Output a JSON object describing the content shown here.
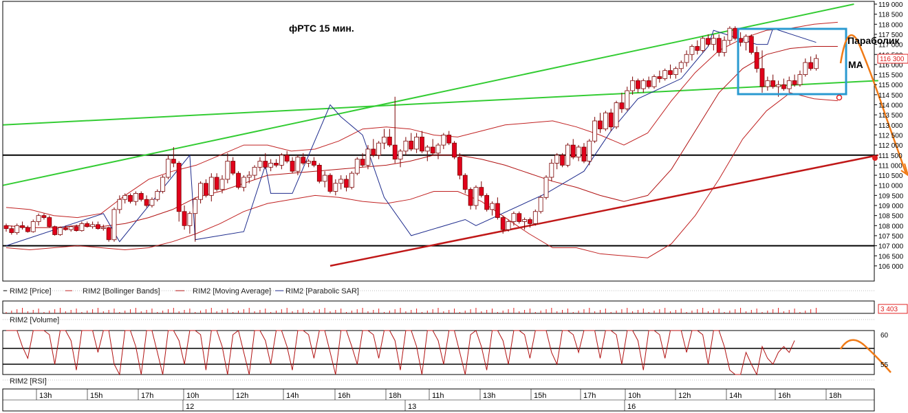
{
  "chart_title": "фРТС   15 мин.",
  "annotations": {
    "parabolic": "Параболик",
    "ma": "MA"
  },
  "price_panel": {
    "legend": [
      "RIM2 [Price]",
      "RIM2 [Bollinger Bands]",
      "RIM2 [Moving Average]",
      "RIM2 [Parabolic SAR]"
    ],
    "y_ticks": [
      "119 000",
      "118 500",
      "118 000",
      "117 500",
      "117 000",
      "116 500",
      "116 000",
      "115 500",
      "115 000",
      "114 500",
      "114 000",
      "113 500",
      "113 000",
      "112 500",
      "112 000",
      "111 500",
      "111 000",
      "110 500",
      "110 000",
      "109 500",
      "109 000",
      "108 500",
      "108 000",
      "107 500",
      "107 000",
      "106 500",
      "106 000"
    ],
    "last_price": "116 300"
  },
  "volume_panel": {
    "legend": "RIM2 [Volume]",
    "last_value": "3 403"
  },
  "rsi_panel": {
    "legend": "RIM2 [RSI]",
    "y_ticks": [
      "60",
      "55"
    ]
  },
  "time_axis": {
    "hours": [
      "13h",
      "15h",
      "17h",
      "10h",
      "12h",
      "14h",
      "16h",
      "18h",
      "11h",
      "13h",
      "15h",
      "17h",
      "10h",
      "12h",
      "14h",
      "16h",
      "18h"
    ],
    "days": [
      "12",
      "13",
      "16"
    ]
  },
  "colors": {
    "up": "#ffffff",
    "down": "#e0001b",
    "bollinger": "#c02020",
    "ma": "#b01010",
    "sar": "#1c2a8c",
    "green_line": "#33cc33",
    "red_trend": "#c01818",
    "box": "#2a9ad0",
    "forecast": "#f07a16"
  },
  "chart_data": {
    "type": "candlestick",
    "title": "фРТС   15 мин.",
    "series_names": [
      "RIM2 [Price]",
      "RIM2 [Bollinger Bands]",
      "RIM2 [Moving Average]",
      "RIM2 [Parabolic SAR]",
      "RIM2 [Volume]",
      "RIM2 [RSI]"
    ],
    "ylim": [
      106000,
      119000
    ],
    "horizontal_levels": [
      111500,
      107000
    ],
    "last_price": 116300,
    "rsi_levels": [
      58,
      56
    ],
    "candles": [
      [
        108000,
        108100,
        107700,
        107850
      ],
      [
        107850,
        108000,
        107550,
        107650
      ],
      [
        107650,
        108100,
        107550,
        108000
      ],
      [
        108000,
        108200,
        107800,
        107900
      ],
      [
        107900,
        108000,
        107650,
        107700
      ],
      [
        107700,
        108300,
        107650,
        108200
      ],
      [
        108200,
        108600,
        108000,
        108500
      ],
      [
        108500,
        108600,
        108300,
        108400
      ],
      [
        108400,
        108500,
        107900,
        107950
      ],
      [
        107950,
        108000,
        107500,
        107550
      ],
      [
        107550,
        107950,
        107500,
        107900
      ],
      [
        107900,
        108000,
        107750,
        107800
      ],
      [
        107800,
        108000,
        107700,
        107950
      ],
      [
        107950,
        108050,
        107700,
        107750
      ],
      [
        107750,
        108200,
        107700,
        108100
      ],
      [
        108100,
        108200,
        107900,
        107950
      ],
      [
        107950,
        108200,
        107850,
        108050
      ],
      [
        108050,
        108200,
        107800,
        107850
      ],
      [
        107850,
        108050,
        107750,
        107900
      ],
      [
        107900,
        107950,
        107200,
        107300
      ],
      [
        107300,
        108900,
        107200,
        108800
      ],
      [
        108800,
        109500,
        108600,
        109300
      ],
      [
        109300,
        109600,
        109100,
        109500
      ],
      [
        109500,
        109600,
        109100,
        109200
      ],
      [
        109200,
        109700,
        109000,
        109600
      ],
      [
        109600,
        109700,
        109200,
        109300
      ],
      [
        109300,
        109500,
        108900,
        109000
      ],
      [
        109000,
        109400,
        108900,
        109300
      ],
      [
        109300,
        109800,
        109200,
        109700
      ],
      [
        109700,
        110500,
        109600,
        110400
      ],
      [
        110400,
        111500,
        110300,
        111300
      ],
      [
        111300,
        111900,
        110900,
        111100
      ],
      [
        111100,
        111200,
        108200,
        108700
      ],
      [
        108700,
        109000,
        107800,
        108000
      ],
      [
        108000,
        108700,
        107600,
        108600
      ],
      [
        108600,
        109400,
        107200,
        109300
      ],
      [
        109300,
        110200,
        109100,
        110100
      ],
      [
        110100,
        110300,
        109400,
        109500
      ],
      [
        109500,
        110600,
        109200,
        110400
      ],
      [
        110400,
        110600,
        109700,
        109800
      ],
      [
        109800,
        110500,
        109600,
        110300
      ],
      [
        110300,
        111600,
        110100,
        111200
      ],
      [
        111200,
        111400,
        110500,
        110600
      ],
      [
        110600,
        110700,
        109800,
        109900
      ],
      [
        109900,
        110500,
        109700,
        110400
      ],
      [
        110400,
        110700,
        110100,
        110500
      ],
      [
        110500,
        111000,
        110300,
        110900
      ],
      [
        110900,
        111400,
        110700,
        111200
      ],
      [
        111200,
        111600,
        110800,
        110900
      ],
      [
        110900,
        111300,
        110700,
        111100
      ],
      [
        111100,
        111300,
        110900,
        111000
      ],
      [
        111000,
        111600,
        110800,
        111500
      ],
      [
        111500,
        111700,
        111100,
        111200
      ],
      [
        111200,
        111400,
        110600,
        110700
      ],
      [
        110700,
        111500,
        110500,
        111400
      ],
      [
        111400,
        111600,
        111000,
        111100
      ],
      [
        111100,
        111300,
        110900,
        111200
      ],
      [
        111200,
        111400,
        110900,
        111000
      ],
      [
        111000,
        111100,
        110100,
        110200
      ],
      [
        110200,
        110700,
        109900,
        110500
      ],
      [
        110500,
        110600,
        109600,
        109700
      ],
      [
        109700,
        110300,
        109500,
        110100
      ],
      [
        110100,
        110500,
        109800,
        110300
      ],
      [
        110300,
        110500,
        109700,
        109900
      ],
      [
        109900,
        110700,
        109800,
        110600
      ],
      [
        110600,
        111400,
        110500,
        111300
      ],
      [
        111300,
        111600,
        110900,
        111000
      ],
      [
        111000,
        112000,
        110800,
        111800
      ],
      [
        111800,
        112300,
        111400,
        111500
      ],
      [
        111500,
        112200,
        111300,
        112100
      ],
      [
        112100,
        112800,
        111800,
        112400
      ],
      [
        112400,
        112800,
        111900,
        112000
      ],
      [
        112000,
        114400,
        111100,
        111300
      ],
      [
        111300,
        111800,
        110900,
        111700
      ],
      [
        111700,
        112400,
        111500,
        112200
      ],
      [
        112200,
        112600,
        111700,
        111800
      ],
      [
        111800,
        112600,
        111600,
        112400
      ],
      [
        112400,
        112700,
        111600,
        111700
      ],
      [
        111700,
        112000,
        111200,
        111900
      ],
      [
        111900,
        112300,
        111500,
        111600
      ],
      [
        111600,
        112100,
        111300,
        112000
      ],
      [
        112000,
        112600,
        111800,
        112500
      ],
      [
        112500,
        112700,
        112000,
        112100
      ],
      [
        112100,
        112200,
        111300,
        111400
      ],
      [
        111400,
        111600,
        110300,
        110500
      ],
      [
        110500,
        110600,
        109600,
        109800
      ],
      [
        109800,
        109900,
        108800,
        109000
      ],
      [
        109000,
        110000,
        108800,
        109900
      ],
      [
        109900,
        110200,
        109400,
        109500
      ],
      [
        109500,
        109600,
        108700,
        108800
      ],
      [
        108800,
        109200,
        108500,
        109100
      ],
      [
        109100,
        109400,
        108300,
        108400
      ],
      [
        108400,
        108500,
        107600,
        107800
      ],
      [
        107800,
        108300,
        107700,
        108200
      ],
      [
        108200,
        108700,
        108000,
        108600
      ],
      [
        108600,
        108700,
        108100,
        108200
      ],
      [
        108200,
        108400,
        107800,
        108300
      ],
      [
        108300,
        108400,
        107900,
        108100
      ],
      [
        108100,
        108800,
        108000,
        108700
      ],
      [
        108700,
        109500,
        108600,
        109400
      ],
      [
        109400,
        110500,
        109300,
        110400
      ],
      [
        110400,
        111300,
        110200,
        111100
      ],
      [
        111100,
        111600,
        110800,
        111500
      ],
      [
        111500,
        111600,
        110900,
        111000
      ],
      [
        111000,
        112100,
        110900,
        112000
      ],
      [
        112000,
        112300,
        111300,
        111400
      ],
      [
        111400,
        112000,
        111200,
        111900
      ],
      [
        111900,
        112100,
        111100,
        111200
      ],
      [
        111200,
        112300,
        111000,
        112200
      ],
      [
        112200,
        113400,
        112100,
        113200
      ],
      [
        113200,
        113600,
        112600,
        112800
      ],
      [
        112800,
        113700,
        112700,
        113600
      ],
      [
        113600,
        113800,
        112700,
        112900
      ],
      [
        112900,
        114200,
        112800,
        114100
      ],
      [
        114100,
        114600,
        113600,
        113800
      ],
      [
        113800,
        114900,
        113700,
        114700
      ],
      [
        114700,
        115400,
        114500,
        115200
      ],
      [
        115200,
        115300,
        114600,
        114800
      ],
      [
        114800,
        115300,
        114600,
        115200
      ],
      [
        115200,
        115400,
        114800,
        114900
      ],
      [
        114900,
        115500,
        114800,
        115400
      ],
      [
        115400,
        115700,
        115100,
        115300
      ],
      [
        115300,
        115800,
        115200,
        115700
      ],
      [
        115700,
        116000,
        115300,
        115500
      ],
      [
        115500,
        115900,
        115300,
        115800
      ],
      [
        115800,
        116200,
        115600,
        116100
      ],
      [
        116100,
        116700,
        115900,
        116500
      ],
      [
        116500,
        117000,
        116200,
        116900
      ],
      [
        116900,
        117200,
        116500,
        116700
      ],
      [
        116700,
        117400,
        116600,
        117300
      ],
      [
        117300,
        117500,
        116900,
        117000
      ],
      [
        117000,
        117500,
        116700,
        117300
      ],
      [
        117300,
        117500,
        116400,
        116600
      ],
      [
        116600,
        117400,
        116400,
        117200
      ],
      [
        117200,
        117900,
        117000,
        117800
      ],
      [
        117800,
        117900,
        117200,
        117300
      ],
      [
        117300,
        117600,
        116900,
        117100
      ],
      [
        117100,
        117500,
        116700,
        117400
      ],
      [
        117400,
        117500,
        116500,
        116600
      ],
      [
        116600,
        116900,
        115600,
        115800
      ],
      [
        115800,
        116700,
        114600,
        114900
      ],
      [
        114900,
        115400,
        114700,
        115200
      ],
      [
        115200,
        115500,
        114800,
        114900
      ],
      [
        114900,
        115200,
        114400,
        115000
      ],
      [
        115000,
        115300,
        114700,
        114800
      ],
      [
        114800,
        115400,
        114600,
        115200
      ],
      [
        115200,
        115500,
        114900,
        115000
      ],
      [
        115000,
        115700,
        114900,
        115500
      ],
      [
        115500,
        116300,
        115400,
        116100
      ],
      [
        116100,
        116400,
        115700,
        115800
      ],
      [
        115800,
        116500,
        115700,
        116300
      ]
    ],
    "bb_upper": [
      108900,
      108800,
      108500,
      108400,
      108600,
      109500,
      110300,
      110700,
      111000,
      111500,
      112000,
      112000,
      111700,
      111800,
      112200,
      112800,
      112900,
      112800,
      112500,
      112400,
      112700,
      113000,
      113100,
      113200,
      112900,
      112500,
      112000,
      112600,
      114200,
      115600,
      116700,
      117300,
      117700,
      117800,
      118000,
      118100
    ],
    "bb_mid": [
      108000,
      107900,
      107900,
      108000,
      107950,
      108100,
      108400,
      108800,
      109400,
      109700,
      110100,
      110500,
      110600,
      110700,
      110800,
      110900,
      111000,
      111200,
      111500,
      111500,
      111300,
      111000,
      110600,
      110200,
      109900,
      109500,
      109200,
      109500,
      110800,
      112700,
      114600,
      115800,
      116500,
      116800,
      116900,
      116900
    ],
    "bb_lower": [
      106900,
      106800,
      106900,
      107000,
      106900,
      106800,
      106900,
      107200,
      107600,
      108100,
      108700,
      109100,
      109300,
      109500,
      109400,
      109200,
      109100,
      109300,
      109700,
      109700,
      109200,
      108400,
      107600,
      106900,
      106900,
      106600,
      106500,
      106400,
      107100,
      108500,
      110300,
      112300,
      113700,
      114600,
      114300,
      114200
    ],
    "sar": [
      [
        0,
        107000
      ],
      [
        18,
        108600
      ],
      [
        21,
        107200
      ],
      [
        34,
        111500
      ],
      [
        35,
        107300
      ],
      [
        44,
        107700
      ],
      [
        48,
        111000
      ],
      [
        49,
        109600
      ],
      [
        53,
        109600
      ],
      [
        60,
        114000
      ],
      [
        62,
        113400
      ],
      [
        66,
        112500
      ],
      [
        70,
        109400
      ],
      [
        75,
        107500
      ],
      [
        85,
        108300
      ],
      [
        87,
        108000
      ],
      [
        100,
        109600
      ],
      [
        107,
        110700
      ],
      [
        112,
        112700
      ],
      [
        117,
        114300
      ],
      [
        125,
        115300
      ],
      [
        130,
        116900
      ],
      [
        131,
        117700
      ],
      [
        139,
        117000
      ],
      [
        141,
        117000
      ],
      [
        142,
        117800
      ],
      [
        150,
        117100
      ]
    ],
    "rsi": [
      65,
      64,
      62,
      58,
      56,
      63,
      68,
      66,
      60,
      55,
      63,
      67,
      59,
      54,
      62,
      66,
      61,
      57,
      64,
      69,
      55,
      52,
      63,
      67,
      58,
      53,
      61,
      66,
      57,
      52,
      64,
      68,
      59,
      55,
      62,
      67,
      60,
      54,
      63,
      66,
      58,
      52,
      60,
      65,
      57,
      53,
      62,
      67,
      59,
      55,
      61,
      66,
      58,
      54,
      63,
      68,
      60,
      56,
      62,
      65,
      57,
      53,
      61,
      66,
      58,
      55,
      63,
      69,
      60,
      56,
      62,
      67,
      59,
      54,
      61,
      66,
      58,
      53,
      62,
      67,
      59,
      55,
      61,
      64,
      57,
      52,
      60,
      65,
      58,
      54,
      61,
      66,
      59,
      55,
      62,
      67,
      60,
      56,
      63,
      68,
      61,
      57,
      55,
      62,
      66,
      60,
      57,
      63,
      68,
      61,
      56,
      62,
      67,
      60,
      55,
      61,
      66,
      59,
      54,
      62,
      67,
      60,
      56,
      63,
      68,
      61,
      57,
      62,
      66,
      60,
      55,
      61,
      65,
      58,
      54,
      52,
      50,
      57,
      55,
      53,
      58,
      56,
      55,
      57,
      58,
      57,
      59
    ]
  }
}
